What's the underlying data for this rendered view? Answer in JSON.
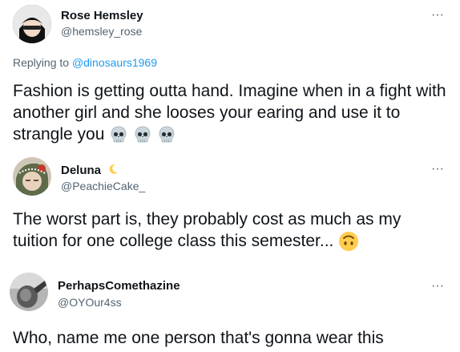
{
  "tweets": [
    {
      "name": "Rose Hemsley",
      "handle": "@hemsley_rose",
      "replying_prefix": "Replying to",
      "replying_to": "@dinosaurs1969",
      "text": "Fashion is getting outta hand. Imagine when in a fight with another girl and she looses your earing and use it to strangle you",
      "more": "···"
    },
    {
      "name": "Deluna",
      "handle": "@PeachieCake_",
      "text": "The worst part is, they probably cost as much as my tuition for one college class this semester...",
      "more": "···"
    },
    {
      "name": "PerhapsComethazine",
      "handle": "@OYOur4ss",
      "text": "Who, name me one person that's gonna wear this",
      "more": "···"
    }
  ],
  "icons": {
    "skull": "skull-emoji",
    "moon": "crescent-moon-emoji",
    "upside_down": "upside-down-face-emoji"
  }
}
